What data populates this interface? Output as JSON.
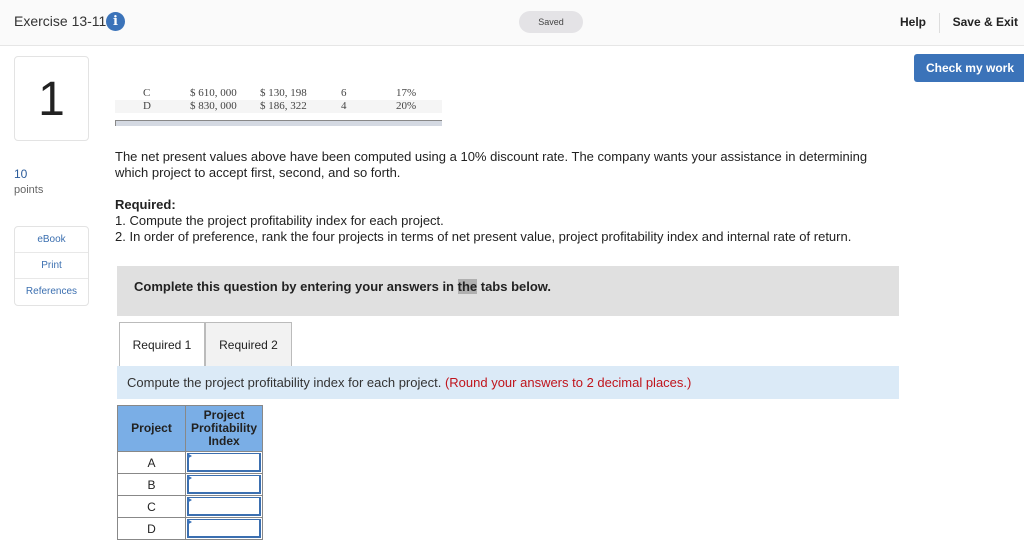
{
  "header": {
    "title": "Exercise 13-11",
    "info_icon": "info-icon",
    "saved": "Saved",
    "help": "Help",
    "save_exit": "Save & Exit"
  },
  "check_button": "Check my work",
  "question": {
    "number": "1",
    "points": "10",
    "points_label": "points"
  },
  "links": [
    "eBook",
    "Print",
    "References"
  ],
  "data_rows": [
    {
      "project": "C",
      "investment": "$ 610, 000",
      "npv": "$ 130, 198",
      "life": "6",
      "irr": "17%"
    },
    {
      "project": "D",
      "investment": "$ 830, 000",
      "npv": "$ 186, 322",
      "life": "4",
      "irr": "20%"
    }
  ],
  "text": {
    "intro1": "The net present values above have been computed using a 10% discount rate. The company wants your assistance in determining",
    "intro2": "which project to accept first, second, and so forth.",
    "required": "Required:",
    "req1": "1. Compute the project profitability index for each project.",
    "req2": "2. In order of preference, rank the four projects in terms of net present value, project profitability index and internal rate of return."
  },
  "banner": {
    "before": "Complete this question by entering your answers in ",
    "highlight": "the",
    "after": " tabs below."
  },
  "tabs": [
    "Required 1",
    "Required 2"
  ],
  "instruction": {
    "text": "Compute the project profitability index for each project. ",
    "note": "(Round your answers to 2 decimal places.)"
  },
  "table": {
    "headers": [
      "Project",
      "Project Profitability Index"
    ],
    "rows": [
      {
        "project": "A",
        "value": ""
      },
      {
        "project": "B",
        "value": ""
      },
      {
        "project": "C",
        "value": ""
      },
      {
        "project": "D",
        "value": ""
      }
    ]
  },
  "colors": {
    "accent": "#3b73b9",
    "header_cell": "#7aaee6",
    "instruction_bg": "#dbeaf7",
    "note": "#c0141c"
  }
}
